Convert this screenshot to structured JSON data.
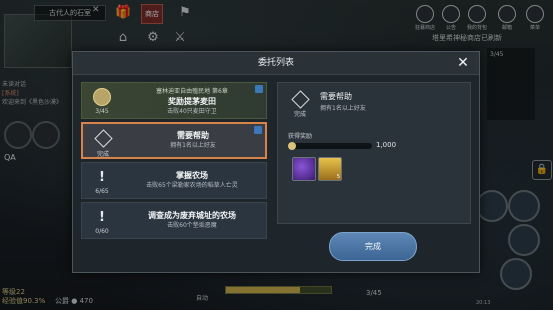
{
  "hud": {
    "player_zone": "古代人的石室",
    "chat_lines": [
      {
        "text": "未读对话"
      },
      {
        "text": "[系统]",
        "system": true
      },
      {
        "text": "欢迎来到《黑色沙漠》"
      }
    ],
    "qa_label": "QA",
    "level_label": "等级22",
    "exp_label": "经验值90.3%",
    "currency_label": "公爵",
    "currency_value": "470",
    "shop_badge": "商店",
    "top_right": [
      {
        "label": "狂暴商店",
        "icon": "shop-icon"
      },
      {
        "label": "公告",
        "icon": "notice-icon"
      },
      {
        "label": "我的背包",
        "icon": "bag-icon"
      },
      {
        "label": "邮箱",
        "icon": "mail-icon"
      },
      {
        "label": "菜单",
        "icon": "menu-icon"
      }
    ],
    "shop_refresh": "塔里希神秘商店已刷新",
    "right_panel_value": "3/45",
    "bottom_value": "3/45",
    "auto_label": "自动",
    "status_line": "20:13"
  },
  "modal": {
    "title": "委托列表",
    "close_icon": "close-icon",
    "quests": [
      {
        "icon": "coin-icon",
        "location": "塞林迪亚自由殖民地 第6章",
        "title": "奖励提茅麦田",
        "desc": "击败40只麦田守卫",
        "status": "3/45",
        "pinned": true,
        "selected": false,
        "tinted": true
      },
      {
        "icon": "diamond-icon",
        "location": "",
        "title": "需要帮助",
        "desc": "拥有1名以上好友",
        "status": "完成",
        "pinned": true,
        "selected": true,
        "tinted": false
      },
      {
        "icon": "exclamation-icon",
        "location": "",
        "title": "掌握农场",
        "desc": "击败65个梁勒家农场的稻草人亡灵",
        "status": "6/65",
        "pinned": false,
        "selected": false,
        "tinted": false
      },
      {
        "icon": "exclamation-icon",
        "location": "",
        "title": "调查成为废弃城址的农场",
        "desc": "击败60个垫垢恶魔",
        "status": "0/60",
        "pinned": false,
        "selected": false,
        "tinted": false
      }
    ],
    "detail": {
      "title": "需要帮助",
      "desc": "拥有1名以上好友",
      "status": "完成",
      "reward_label": "获得奖励",
      "exp_value": "1,000",
      "items": [
        {
          "icon": "purple-gem-icon",
          "count": ""
        },
        {
          "icon": "potion-icon",
          "count": "5"
        }
      ]
    },
    "complete_button": "完成"
  }
}
